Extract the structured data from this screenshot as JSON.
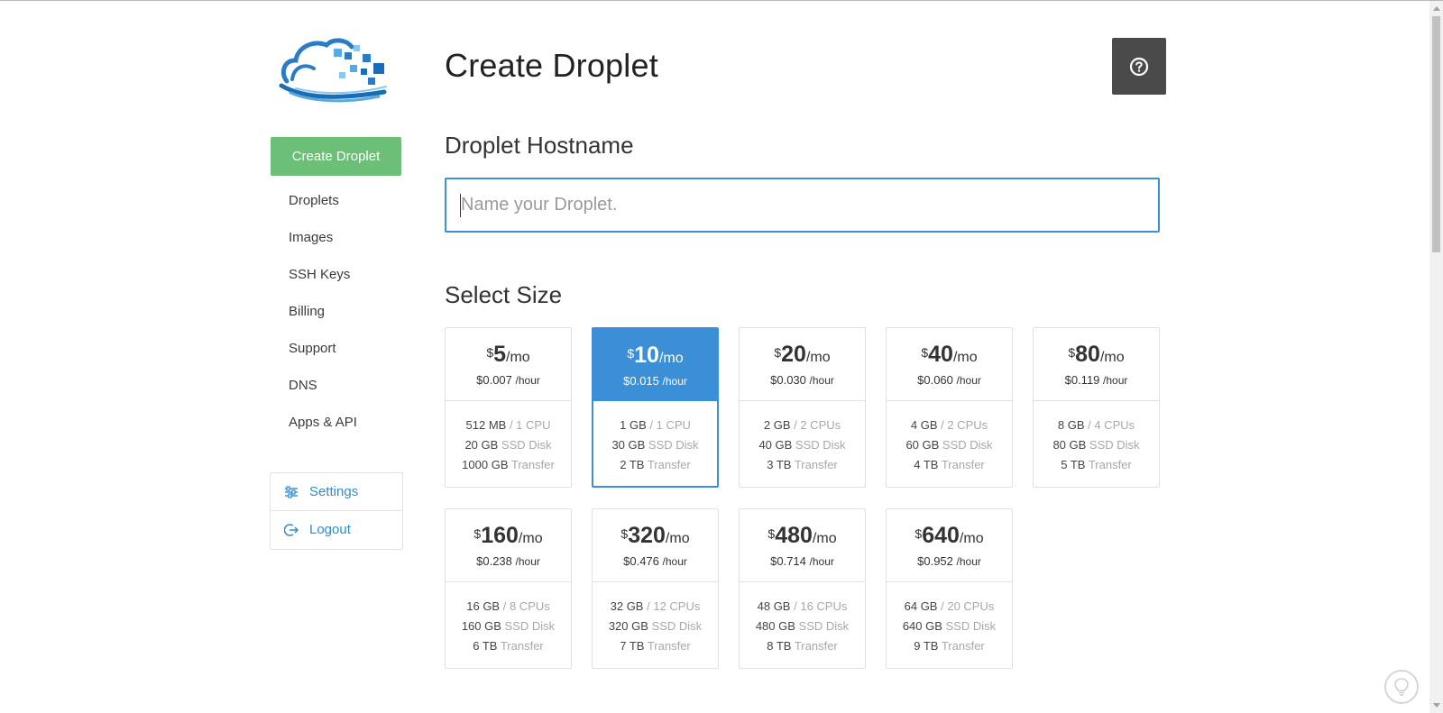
{
  "colors": {
    "accent": "#3a8fd6",
    "create_button": "#6cbf76",
    "help_button": "#4a4a4a"
  },
  "header": {
    "title": "Create Droplet"
  },
  "sidebar": {
    "create_label": "Create Droplet",
    "items": [
      {
        "label": "Droplets"
      },
      {
        "label": "Images"
      },
      {
        "label": "SSH Keys"
      },
      {
        "label": "Billing"
      },
      {
        "label": "Support"
      },
      {
        "label": "DNS"
      },
      {
        "label": "Apps & API"
      }
    ],
    "account": [
      {
        "label": "Settings",
        "icon": "sliders-icon"
      },
      {
        "label": "Logout",
        "icon": "logout-icon"
      }
    ]
  },
  "hostname": {
    "heading": "Droplet Hostname",
    "placeholder": "Name your Droplet.",
    "value": ""
  },
  "size": {
    "heading": "Select Size",
    "selected_index": 1,
    "options": [
      {
        "currency": "$",
        "price": "5",
        "per": "/mo",
        "hourly": "$0.007",
        "hourly_unit": "/hour",
        "mem": "512 MB",
        "cpu": "/ 1 CPU",
        "disk": "20 GB",
        "disk_label": "SSD Disk",
        "transfer": "1000 GB",
        "transfer_label": "Transfer"
      },
      {
        "currency": "$",
        "price": "10",
        "per": "/mo",
        "hourly": "$0.015",
        "hourly_unit": "/hour",
        "mem": "1 GB",
        "cpu": "/ 1 CPU",
        "disk": "30 GB",
        "disk_label": "SSD Disk",
        "transfer": "2 TB",
        "transfer_label": "Transfer"
      },
      {
        "currency": "$",
        "price": "20",
        "per": "/mo",
        "hourly": "$0.030",
        "hourly_unit": "/hour",
        "mem": "2 GB",
        "cpu": "/ 2 CPUs",
        "disk": "40 GB",
        "disk_label": "SSD Disk",
        "transfer": "3 TB",
        "transfer_label": "Transfer"
      },
      {
        "currency": "$",
        "price": "40",
        "per": "/mo",
        "hourly": "$0.060",
        "hourly_unit": "/hour",
        "mem": "4 GB",
        "cpu": "/ 2 CPUs",
        "disk": "60 GB",
        "disk_label": "SSD Disk",
        "transfer": "4 TB",
        "transfer_label": "Transfer"
      },
      {
        "currency": "$",
        "price": "80",
        "per": "/mo",
        "hourly": "$0.119",
        "hourly_unit": "/hour",
        "mem": "8 GB",
        "cpu": "/ 4 CPUs",
        "disk": "80 GB",
        "disk_label": "SSD Disk",
        "transfer": "5 TB",
        "transfer_label": "Transfer"
      },
      {
        "currency": "$",
        "price": "160",
        "per": "/mo",
        "hourly": "$0.238",
        "hourly_unit": "/hour",
        "mem": "16 GB",
        "cpu": "/ 8 CPUs",
        "disk": "160 GB",
        "disk_label": "SSD Disk",
        "transfer": "6 TB",
        "transfer_label": "Transfer"
      },
      {
        "currency": "$",
        "price": "320",
        "per": "/mo",
        "hourly": "$0.476",
        "hourly_unit": "/hour",
        "mem": "32 GB",
        "cpu": "/ 12 CPUs",
        "disk": "320 GB",
        "disk_label": "SSD Disk",
        "transfer": "7 TB",
        "transfer_label": "Transfer"
      },
      {
        "currency": "$",
        "price": "480",
        "per": "/mo",
        "hourly": "$0.714",
        "hourly_unit": "/hour",
        "mem": "48 GB",
        "cpu": "/ 16 CPUs",
        "disk": "480 GB",
        "disk_label": "SSD Disk",
        "transfer": "8 TB",
        "transfer_label": "Transfer"
      },
      {
        "currency": "$",
        "price": "640",
        "per": "/mo",
        "hourly": "$0.952",
        "hourly_unit": "/hour",
        "mem": "64 GB",
        "cpu": "/ 20 CPUs",
        "disk": "640 GB",
        "disk_label": "SSD Disk",
        "transfer": "9 TB",
        "transfer_label": "Transfer"
      }
    ]
  },
  "icons": {
    "logo": "cloud-logo",
    "help": "question-circle-icon",
    "lightbulb": "lightbulb-icon"
  }
}
